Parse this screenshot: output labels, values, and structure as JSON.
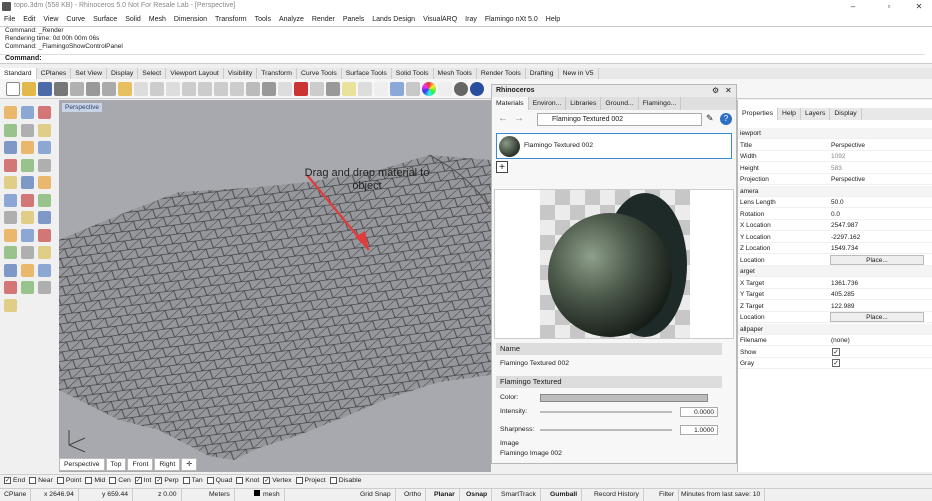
{
  "window": {
    "title": "topo.3dm (558 KB) - Rhinoceros 5.0 Not For Resale Lab - [Perspective]"
  },
  "menu": [
    "File",
    "Edit",
    "View",
    "Curve",
    "Surface",
    "Solid",
    "Mesh",
    "Dimension",
    "Transform",
    "Tools",
    "Analyze",
    "Render",
    "Panels",
    "Lands Design",
    "VisualARQ",
    "Iray",
    "Flamingo nXt 5.0",
    "Help"
  ],
  "command_history": [
    "Command: _Render",
    "Rendering time: 0d 00h 00m 06s",
    "Command: _FlamingoShowControlPanel"
  ],
  "command_prompt": "Command:",
  "toolbar_tabs": [
    "Standard",
    "CPlanes",
    "Set View",
    "Display",
    "Select",
    "Viewport Layout",
    "Visibility",
    "Transform",
    "Curve Tools",
    "Surface Tools",
    "Solid Tools",
    "Mesh Tools",
    "Render Tools",
    "Drafting",
    "New in V5"
  ],
  "viewport": {
    "label": "Perspective",
    "tabs": [
      "Perspective",
      "Top",
      "Front",
      "Right"
    ]
  },
  "annotation": "Drag and drop material to object",
  "flamingo": {
    "title": "Rhinoceros",
    "tabs": [
      "Materials",
      "Environ...",
      "Libraries",
      "Ground...",
      "Flamingo..."
    ],
    "selected_material": "Flamingo Textured 002",
    "material_item": "Flamingo Textured 002",
    "name_section": "Name",
    "name_value": "Flamingo Textured 002",
    "type_section": "Flamingo Textured",
    "color_label": "Color:",
    "intensity_label": "Intensity:",
    "intensity_value": "0.0000",
    "sharpness_label": "Sharpness:",
    "sharpness_value": "1.0000",
    "image_label": "Image",
    "image_value": "Flamingo Image 002"
  },
  "properties": {
    "tabs": [
      "Properties",
      "Help",
      "Layers",
      "Display"
    ],
    "rows": [
      {
        "k": "iewport",
        "v": "",
        "type": "sec"
      },
      {
        "k": "Title",
        "v": "Perspective"
      },
      {
        "k": "Width",
        "v": "1092"
      },
      {
        "k": "Height",
        "v": "583"
      },
      {
        "k": "Projection",
        "v": "Perspective"
      },
      {
        "k": "amera",
        "v": "",
        "type": "sec"
      },
      {
        "k": "Lens Length",
        "v": "50.0"
      },
      {
        "k": "Rotation",
        "v": "0.0"
      },
      {
        "k": "X Location",
        "v": "2547.987"
      },
      {
        "k": "Y Location",
        "v": "-2297.162"
      },
      {
        "k": "Z Location",
        "v": "1549.734"
      },
      {
        "k": "Location",
        "v": "Place...",
        "type": "btn"
      },
      {
        "k": "arget",
        "v": "",
        "type": "sec"
      },
      {
        "k": "X Target",
        "v": "1361.736"
      },
      {
        "k": "Y Target",
        "v": "405.285"
      },
      {
        "k": "Z Target",
        "v": "122.989"
      },
      {
        "k": "Location",
        "v": "Place...",
        "type": "btn"
      },
      {
        "k": "allpaper",
        "v": "",
        "type": "sec"
      },
      {
        "k": "Filename",
        "v": "(none)"
      },
      {
        "k": "Show",
        "v": "✓",
        "type": "chk"
      },
      {
        "k": "Gray",
        "v": "✓",
        "type": "chk"
      }
    ]
  },
  "osnap": [
    {
      "label": "End",
      "checked": true
    },
    {
      "label": "Near",
      "checked": false
    },
    {
      "label": "Point",
      "checked": false
    },
    {
      "label": "Mid",
      "checked": false
    },
    {
      "label": "Cen",
      "checked": false
    },
    {
      "label": "Int",
      "checked": true
    },
    {
      "label": "Perp",
      "checked": true
    },
    {
      "label": "Tan",
      "checked": false
    },
    {
      "label": "Quad",
      "checked": false
    },
    {
      "label": "Knot",
      "checked": false
    },
    {
      "label": "Vertex",
      "checked": true
    },
    {
      "label": "Project",
      "checked": false
    },
    {
      "label": "Disable",
      "checked": false
    }
  ],
  "status": {
    "cplane": "CPlane",
    "x": "x 2646.94",
    "y": "y 659.44",
    "z": "z 0.00",
    "units": "Meters",
    "layer": "mesh",
    "grid_snap": "Grid Snap",
    "ortho": "Ortho",
    "planar": "Planar",
    "osnap": "Osnap",
    "smarttrack": "SmartTrack",
    "gumball": "Gumball",
    "record_history": "Record History",
    "filter": "Filter",
    "autosave": "Minutes from last save: 10"
  },
  "colors": {
    "accent": "#3a8bd6",
    "arrow": "#e23b3b",
    "viewport_bg": "#a7a9ae"
  }
}
